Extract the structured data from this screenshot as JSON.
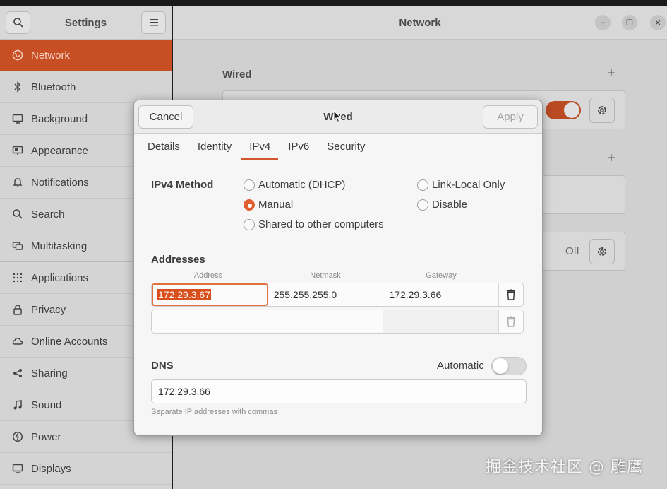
{
  "sidebar": {
    "title": "Settings",
    "items": [
      {
        "label": "Network",
        "icon": "network-icon",
        "active": true
      },
      {
        "label": "Bluetooth",
        "icon": "bluetooth-icon"
      },
      {
        "label": "Background",
        "icon": "background-icon"
      },
      {
        "label": "Appearance",
        "icon": "appearance-icon"
      },
      {
        "label": "Notifications",
        "icon": "bell-icon"
      },
      {
        "label": "Search",
        "icon": "search-icon"
      },
      {
        "label": "Multitasking",
        "icon": "multitasking-icon"
      },
      {
        "label": "Applications",
        "icon": "grid-icon"
      },
      {
        "label": "Privacy",
        "icon": "lock-icon"
      },
      {
        "label": "Online Accounts",
        "icon": "cloud-icon"
      },
      {
        "label": "Sharing",
        "icon": "share-icon"
      },
      {
        "label": "Sound",
        "icon": "music-note-icon"
      },
      {
        "label": "Power",
        "icon": "power-icon"
      },
      {
        "label": "Displays",
        "icon": "display-icon"
      }
    ]
  },
  "main": {
    "title": "Network",
    "wired_label": "Wired",
    "off_label": "Off"
  },
  "dialog": {
    "title": "Wired",
    "cancel_label": "Cancel",
    "apply_label": "Apply",
    "tabs": [
      "Details",
      "Identity",
      "IPv4",
      "IPv6",
      "Security"
    ],
    "active_tab": "IPv4",
    "ipv4_method_label": "IPv4 Method",
    "methods": {
      "automatic": "Automatic (DHCP)",
      "manual": "Manual",
      "shared": "Shared to other computers",
      "link_local": "Link-Local Only",
      "disable": "Disable"
    },
    "selected_method": "Manual",
    "addresses_label": "Addresses",
    "columns": [
      "Address",
      "Netmask",
      "Gateway"
    ],
    "rows": [
      {
        "address": "172.29.3.67",
        "netmask": "255.255.255.0",
        "gateway": "172.29.3.66"
      },
      {
        "address": "",
        "netmask": "",
        "gateway": ""
      }
    ],
    "dns_label": "DNS",
    "dns_automatic_label": "Automatic",
    "dns_automatic_on": false,
    "dns_value": "172.29.3.66",
    "dns_hint": "Separate IP addresses with commas"
  },
  "watermark": "掘金技术社区 @ 雕鹰",
  "colors": {
    "accent": "#c84f24",
    "selection": "#d94f1c"
  }
}
